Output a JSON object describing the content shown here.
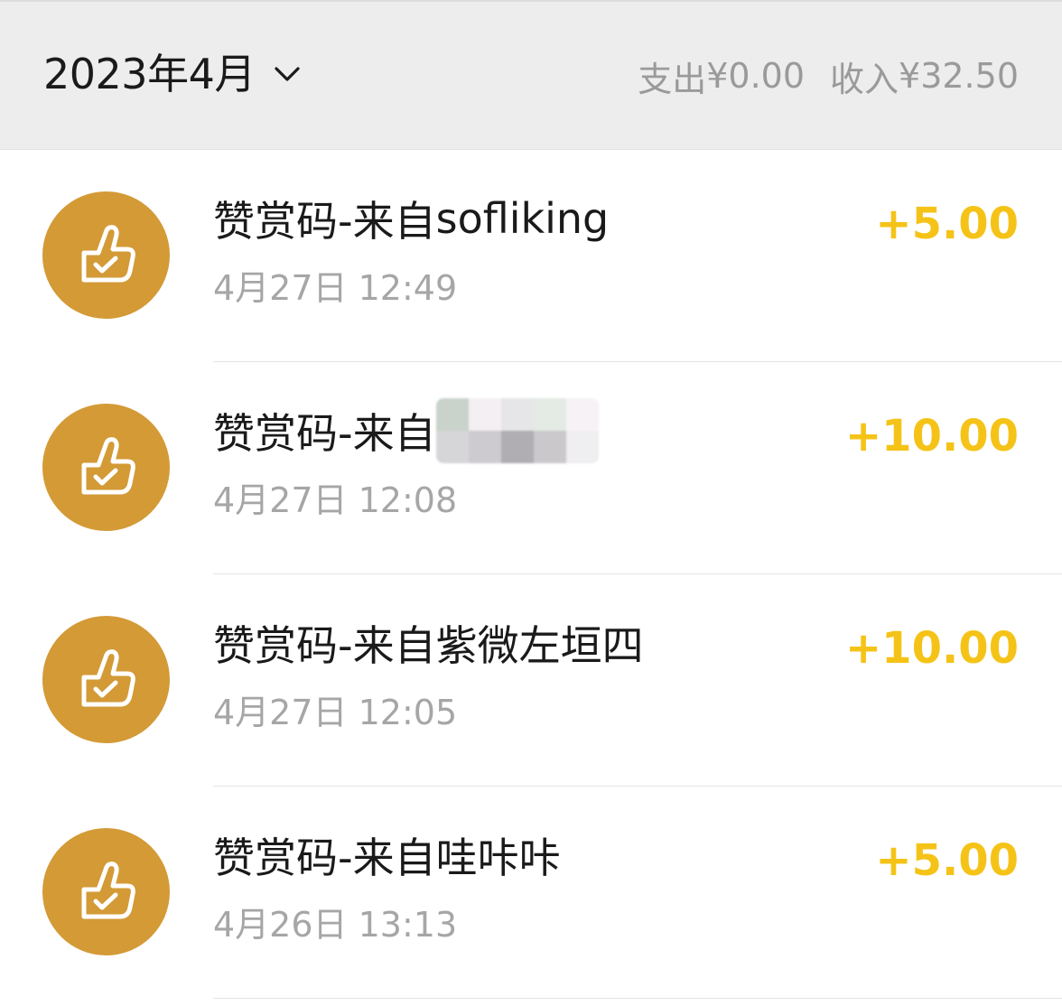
{
  "header": {
    "month_label": "2023年4月",
    "expense_label": "支出",
    "expense_value": "¥0.00",
    "income_label": "收入",
    "income_value": "¥32.50"
  },
  "transactions": [
    {
      "title_prefix": "赞赏码-来自",
      "sender": "sofliking",
      "time": "4月27日 12:49",
      "amount": "+5.00",
      "sender_redacted": false
    },
    {
      "title_prefix": "赞赏码-来自",
      "sender": "",
      "time": "4月27日 12:08",
      "amount": "+10.00",
      "sender_redacted": true
    },
    {
      "title_prefix": "赞赏码-来自",
      "sender": "紫微左垣四",
      "time": "4月27日 12:05",
      "amount": "+10.00",
      "sender_redacted": false
    },
    {
      "title_prefix": "赞赏码-来自",
      "sender": "哇咔咔",
      "time": "4月26日 13:13",
      "amount": "+5.00",
      "sender_redacted": false
    }
  ],
  "icons": {
    "avatar_icon": "thumbs-up-check-icon",
    "dropdown_icon": "chevron-down-icon"
  },
  "colors": {
    "avatar_bg": "#d39a36",
    "amount": "#f5c318",
    "header_bg": "#ededed"
  }
}
